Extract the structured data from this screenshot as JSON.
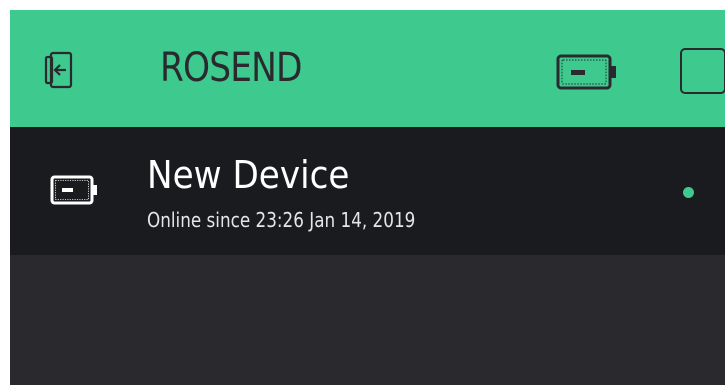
{
  "header": {
    "title": "ROSEND",
    "back_icon": "device-exit-icon",
    "device_icon": "device-icon",
    "square_button_icon": "square-icon",
    "background_color": "#3ec98e"
  },
  "devices": [
    {
      "name": "New Device",
      "status": "Online since 23:26 Jan 14, 2019",
      "icon": "device-icon",
      "online": true,
      "status_color": "#3ec98e"
    }
  ]
}
